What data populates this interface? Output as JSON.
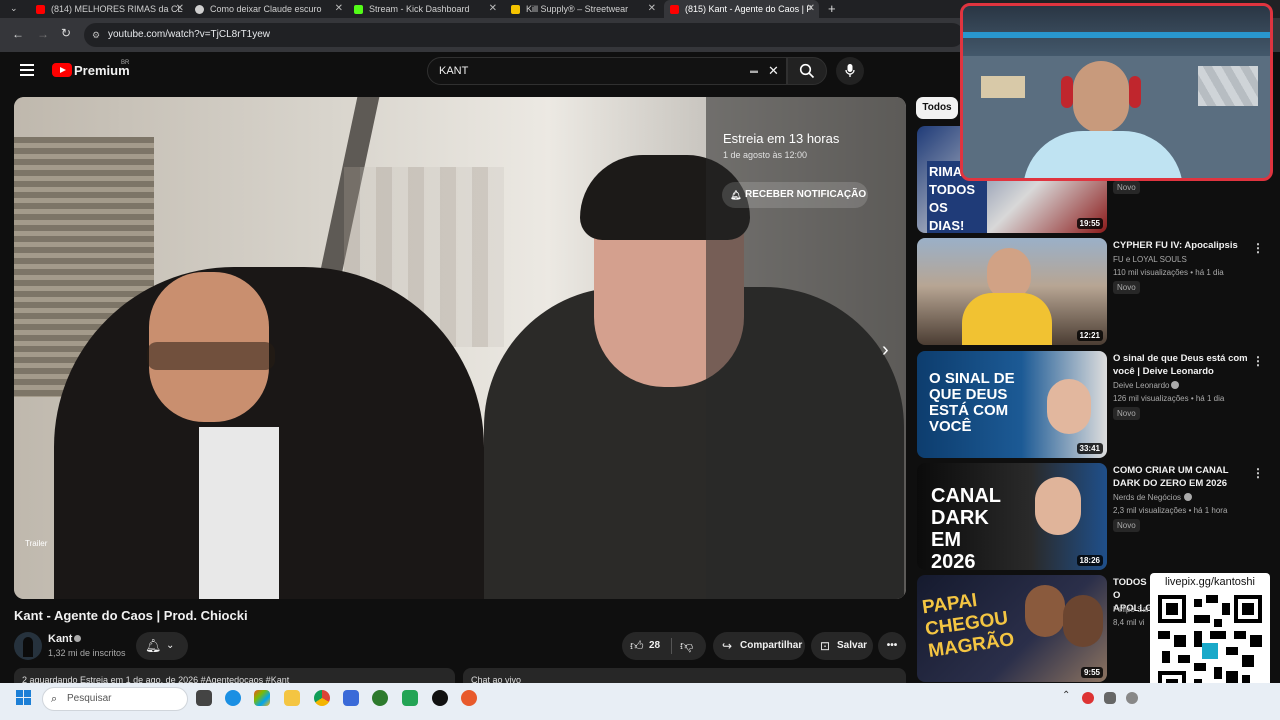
{
  "browser": {
    "tabs": [
      {
        "label": "(814) MELHORES RIMAS da CL",
        "color": "#ff0000"
      },
      {
        "label": "Como deixar Claude escuro",
        "color": "#cfcfcf"
      },
      {
        "label": "Stream - Kick Dashboard",
        "color": "#53fc18"
      },
      {
        "label": "Kill Supply® – Streetwear",
        "color": "#f5c400"
      },
      {
        "label": "(815) Kant - Agente do Caos | P",
        "color": "#ff0000"
      }
    ],
    "url": "youtube.com/watch?v=TjCL8rT1yew"
  },
  "youtube": {
    "logo": "Premium",
    "region": "BR",
    "search_value": "KANT"
  },
  "player": {
    "premiere_title": "Estreia em 13 horas",
    "premiere_date": "1 de agosto às 12:00",
    "notify_button": "RECEBER NOTIFICAÇÃO",
    "trailer_label": "Trailer"
  },
  "video": {
    "title": "Kant - Agente do Caos | Prod. Chiocki",
    "channel": "Kant",
    "subscribers": "1,32 mi de inscritos",
    "likes": "28",
    "share": "Compartilhar",
    "save": "Salvar",
    "description_preview": "2 aguardando  Estreia em 1 de ago. de 2026  #Agentedocaos #Kant",
    "chat_label": "Chat ao vivo"
  },
  "sidebar": {
    "chip": "Todos",
    "videos": [
      {
        "title": "",
        "channel": "",
        "meta": "",
        "badge": "Novo",
        "duration": "19:55",
        "thumb_text": "RIMAN TODOS OS DIAS!"
      },
      {
        "title": "CYPHER FU IV: Apocalipsis",
        "channel": "FU e LOYAL SOULS",
        "meta": "110 mil visualizações • há 1 dia",
        "badge": "Novo",
        "duration": "12:21",
        "thumb_text": ""
      },
      {
        "title": "O sinal de que Deus está com você | Deive Leonardo",
        "channel": "Deive Leonardo",
        "meta": "126 mil visualizações • há 1 dia",
        "badge": "Novo",
        "duration": "33:41",
        "thumb_text": "O SINAL DE QUE DEUS ESTÁ COM VOCÊ"
      },
      {
        "title": "COMO CRIAR UM CANAL DARK DO ZERO EM 2026",
        "channel": "Nerds de Negócios",
        "meta": "2,3 mil visualizações • há 1 hora",
        "badge": "Novo",
        "duration": "18:26",
        "thumb_text": "CANAL DARK EM 2026"
      },
      {
        "title": "TODOS O APOLLO",
        "channel": "Felipe San",
        "meta": "8,4 mil vi",
        "badge": "",
        "duration": "9:55",
        "thumb_text": "PAPAI CHEGOU MAGRÃO"
      }
    ]
  },
  "overlay": {
    "qr_label": "livepix.gg/kantoshi"
  },
  "taskbar": {
    "search_placeholder": "Pesquisar"
  }
}
